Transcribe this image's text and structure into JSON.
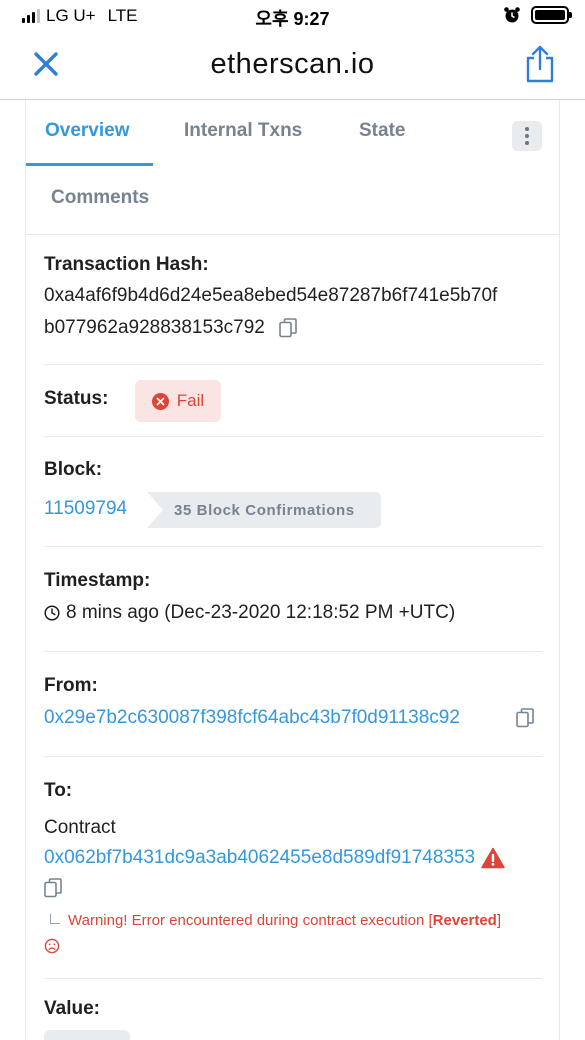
{
  "status_bar": {
    "carrier": "LG U+",
    "network": "LTE",
    "time": "오후 9:27"
  },
  "browser": {
    "host": "etherscan.io",
    "close_icon": "close-icon",
    "share_icon": "share-icon"
  },
  "tabs": [
    {
      "label": "Overview",
      "active": true
    },
    {
      "label": "Internal Txns",
      "active": false
    },
    {
      "label": "State",
      "active": false
    },
    {
      "label": "Comments",
      "active": false
    }
  ],
  "transaction": {
    "hash_label": "Transaction Hash:",
    "hash_line1": "0xa4af6f9b4d6d24e5ea8ebed54e87287b6f741e5b70f",
    "hash_line2": "b077962a928838153c792",
    "status_label": "Status:",
    "status_value": "Fail",
    "block_label": "Block:",
    "block_number": "11509794",
    "block_confirmations": "35 Block Confirmations",
    "timestamp_label": "Timestamp:",
    "timestamp_value": "8 mins ago (Dec-23-2020 12:18:52 PM +UTC)",
    "from_label": "From:",
    "from_address": "0x29e7b2c630087f398fcf64abc43b7f0d91138c92",
    "to_label": "To:",
    "to_type": "Contract",
    "to_address": "0x062bf7b431dc9a3ab4062455e8d589df91748353",
    "warning_text": "Warning! Error encountered during contract execution [",
    "warning_reverted": "Reverted",
    "warning_close": "]",
    "value_label": "Value:"
  },
  "colors": {
    "accent": "#3498db",
    "danger": "#de4437",
    "danger_bg": "#fbe4e4",
    "muted": "#77838f",
    "badge_bg": "#e9ecef"
  }
}
